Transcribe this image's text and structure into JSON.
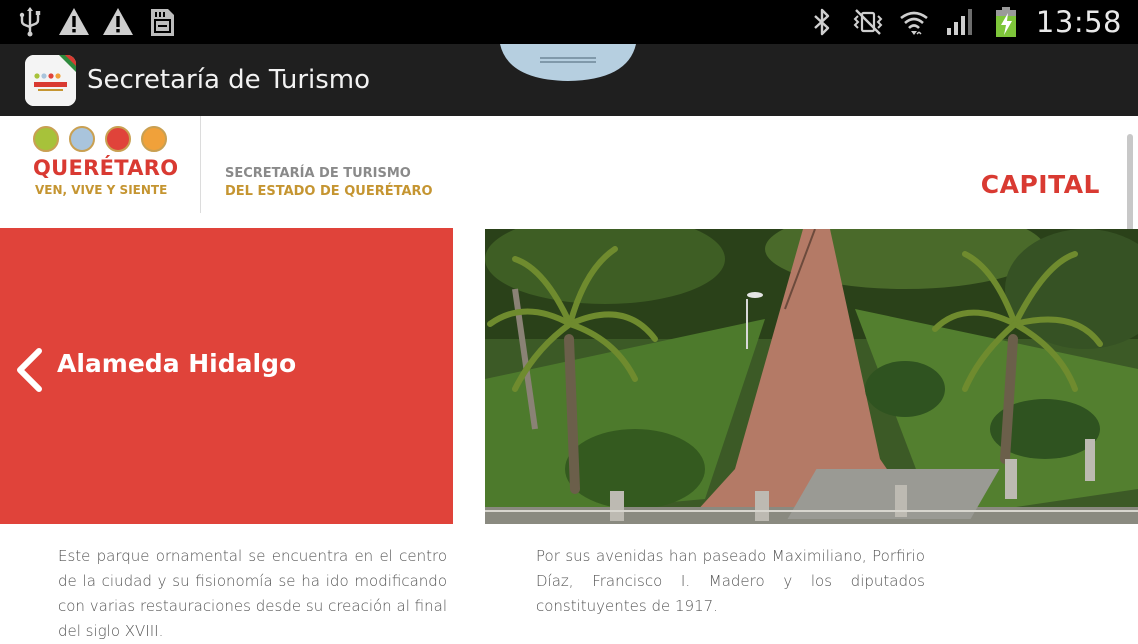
{
  "status_bar": {
    "time": "13:58",
    "left_icons": [
      "usb-icon",
      "warning-icon",
      "warning-icon",
      "sd-card-icon"
    ],
    "right_icons": [
      "bluetooth-icon",
      "vibrate-icon",
      "wifi-icon",
      "signal-icon",
      "battery-charging-icon"
    ]
  },
  "action_bar": {
    "title": "Secretaría de Turismo"
  },
  "header": {
    "logo_name": "QUERÉTARO",
    "logo_tagline": "VEN, VIVE Y SIENTE",
    "logo_dot_colors": [
      "#a7c23a",
      "#a9c4dc",
      "#e0433a",
      "#f0a13a"
    ],
    "secretaria_line1": "SECRETARÍA DE TURISMO",
    "secretaria_line2": "DEL ESTADO DE QUERÉTARO",
    "region": "CAPITAL"
  },
  "place": {
    "title": "Alameda Hidalgo",
    "paragraph_1": "Este parque ornamental se encuentra en el centro de la ciudad y su fisionomía se ha ido modificando con varias restauraciones desde su creación al final del siglo XVIII.",
    "paragraph_2": "Por sus avenidas han paseado Maximiliano, Porfirio Díaz, Francisco I. Madero y los diputados constituyentes de 1917."
  },
  "colors": {
    "accent_red": "#e0433a",
    "gold": "#c59531",
    "action_bar": "#1f1f1f",
    "status_bar": "#000000"
  }
}
